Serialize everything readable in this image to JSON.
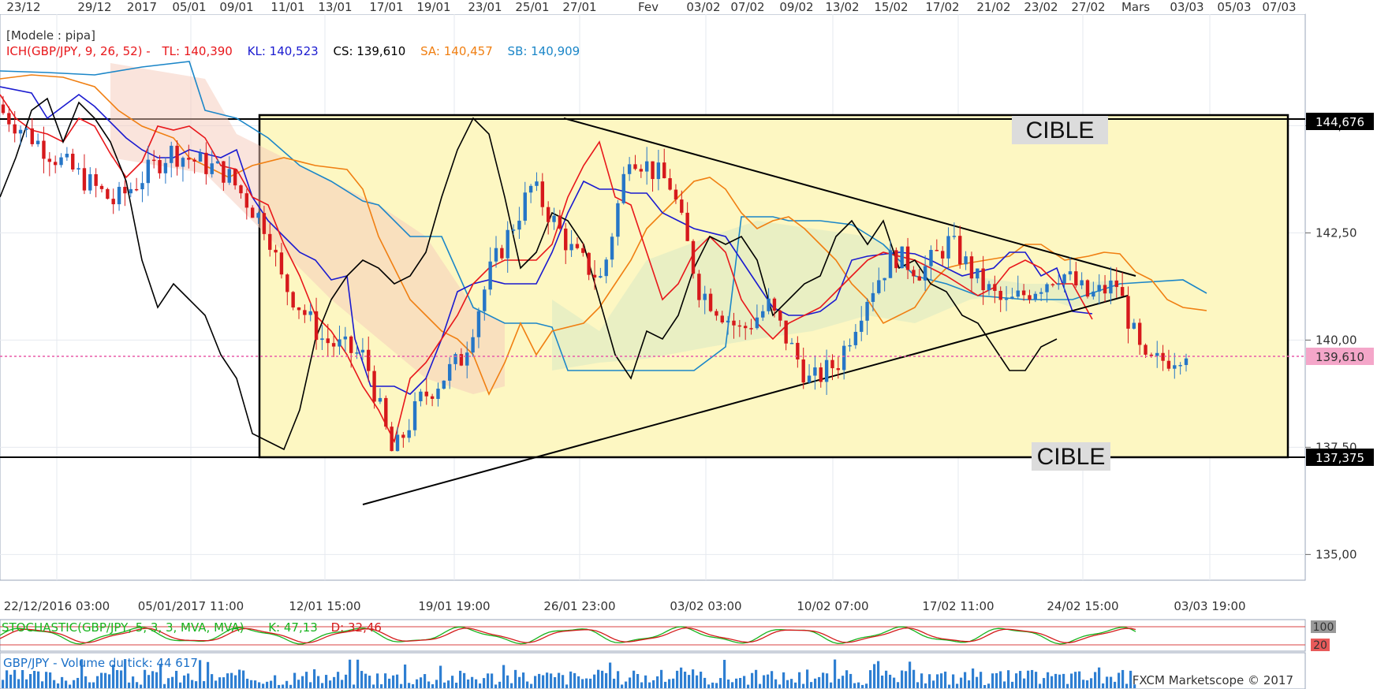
{
  "chart_data": {
    "type": "line",
    "instrument": "GBP/JPY",
    "top_dates": [
      "23/12",
      "29/12",
      "2017",
      "05/01",
      "09/01",
      "11/01",
      "13/01",
      "17/01",
      "19/01",
      "23/01",
      "25/01",
      "27/01",
      "Fev",
      "03/02",
      "07/02",
      "09/02",
      "13/02",
      "15/02",
      "17/02",
      "21/02",
      "23/02",
      "27/02",
      "Mars",
      "03/03",
      "05/03",
      "07/03"
    ],
    "bottom_dates": [
      "22/12/2016 03:00",
      "05/01/2017 11:00",
      "12/01 15:00",
      "19/01 19:00",
      "26/01 23:00",
      "03/02 03:00",
      "10/02 07:00",
      "17/02 11:00",
      "24/02 15:00",
      "03/03 19:00"
    ],
    "y_ticks": [
      "145,00",
      "142,50",
      "140,00",
      "137,50",
      "135,00"
    ],
    "y_tick_values": [
      145.0,
      142.5,
      140.0,
      137.5,
      135.0
    ],
    "ylim": [
      134.4,
      147.6
    ],
    "model_label": "[Modele : pipa]",
    "ichimoku": {
      "label": "ICH(GBP/JPY, 9, 26, 52) -",
      "TL": "TL: 140,390",
      "KL": "KL: 140,523",
      "CS": "CS: 139,610",
      "SA": "SA: 140,457",
      "SB": "SB: 140,909"
    },
    "levels": {
      "upper": 144.676,
      "upper_label": "144,676",
      "lower": 137.375,
      "lower_label": "137,375",
      "current": 139.61,
      "current_label": "139,610"
    },
    "annotations": {
      "target_upper": "CIBLE",
      "target_lower": "CIBLE"
    },
    "price_path_x": [
      0,
      0.04,
      0.08,
      0.12,
      0.16,
      0.19,
      0.2,
      0.23,
      0.26,
      0.28,
      0.3,
      0.33,
      0.35,
      0.38,
      0.41,
      0.43,
      0.45,
      0.48,
      0.5,
      0.53,
      0.55,
      0.58,
      0.6,
      0.62,
      0.64,
      0.66,
      0.68,
      0.7,
      0.72,
      0.74,
      0.76,
      0.78,
      0.8,
      0.82,
      0.84,
      0.85
    ],
    "price_path_y": [
      145.3,
      144.2,
      143.2,
      144.4,
      143.9,
      142.6,
      141.4,
      140.0,
      139.6,
      137.3,
      138.6,
      139.6,
      141.6,
      143.6,
      142.0,
      141.4,
      144.4,
      143.6,
      141.2,
      140.2,
      140.8,
      139.0,
      139.5,
      141.0,
      142.0,
      141.6,
      142.3,
      141.4,
      140.8,
      141.2,
      141.6,
      141.0,
      141.3,
      139.4,
      139.6,
      139.8
    ],
    "stochastic": {
      "label": "STOCHASTIC(GBP/JPY, 5, 3, 3, MVA, MVA)",
      "K": "K: 47,13",
      "D": "D: 32,46",
      "levels": [
        "100",
        "20"
      ]
    },
    "volume": {
      "label": "GBP/JPY - Volume du tick: 44 617"
    },
    "footer": "FXCM Marketscope © 2017",
    "colors": {
      "tenkan": "#e8171b",
      "kijun": "#1a1ad0",
      "chikou": "#000000",
      "senkou_a": "#f07f12",
      "senkou_b": "#1b86c8",
      "box_fill": "#fdf7c2",
      "candle_up": "#2676c7",
      "candle_down": "#d6191c",
      "current_line": "#e85aa9"
    }
  }
}
